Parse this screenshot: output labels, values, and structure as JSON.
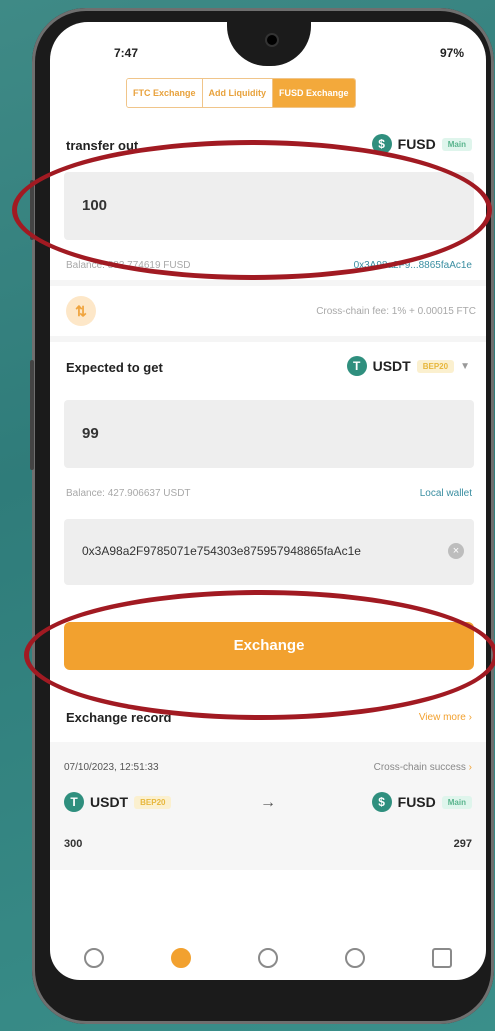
{
  "status_bar": {
    "time": "7:47",
    "right": "97%"
  },
  "tabs": [
    {
      "label": "FTC Exchange",
      "active": false
    },
    {
      "label": "Add Liquidity",
      "active": false
    },
    {
      "label": "FUSD Exchange",
      "active": true
    }
  ],
  "transfer_out": {
    "label": "transfer out",
    "token": "FUSD",
    "network": "Main",
    "amount": "100",
    "balance": "Balance: 883.774619 FUSD",
    "address_short": "0x3A98a2F9...8865faAc1e"
  },
  "fee": {
    "text": "Cross-chain fee: 1% + 0.00015 FTC"
  },
  "expected": {
    "label": "Expected to get",
    "token": "USDT",
    "network": "BEP20",
    "amount": "99",
    "balance": "Balance: 427.906637 USDT",
    "wallet_link": "Local wallet",
    "address": "0x3A98a2F9785071e754303e875957948865faAc1e"
  },
  "exchange_button": "Exchange",
  "record": {
    "title": "Exchange record",
    "view_more": "View more",
    "date": "07/10/2023, 12:51:33",
    "status": "Cross-chain success",
    "from_token": "USDT",
    "from_network": "BEP20",
    "to_token": "FUSD",
    "to_network": "Main",
    "from_amount": "300",
    "to_amount": "297"
  },
  "colors": {
    "accent": "#f2a12f",
    "teal": "#2f8f7e",
    "annotation": "#a11a22"
  }
}
